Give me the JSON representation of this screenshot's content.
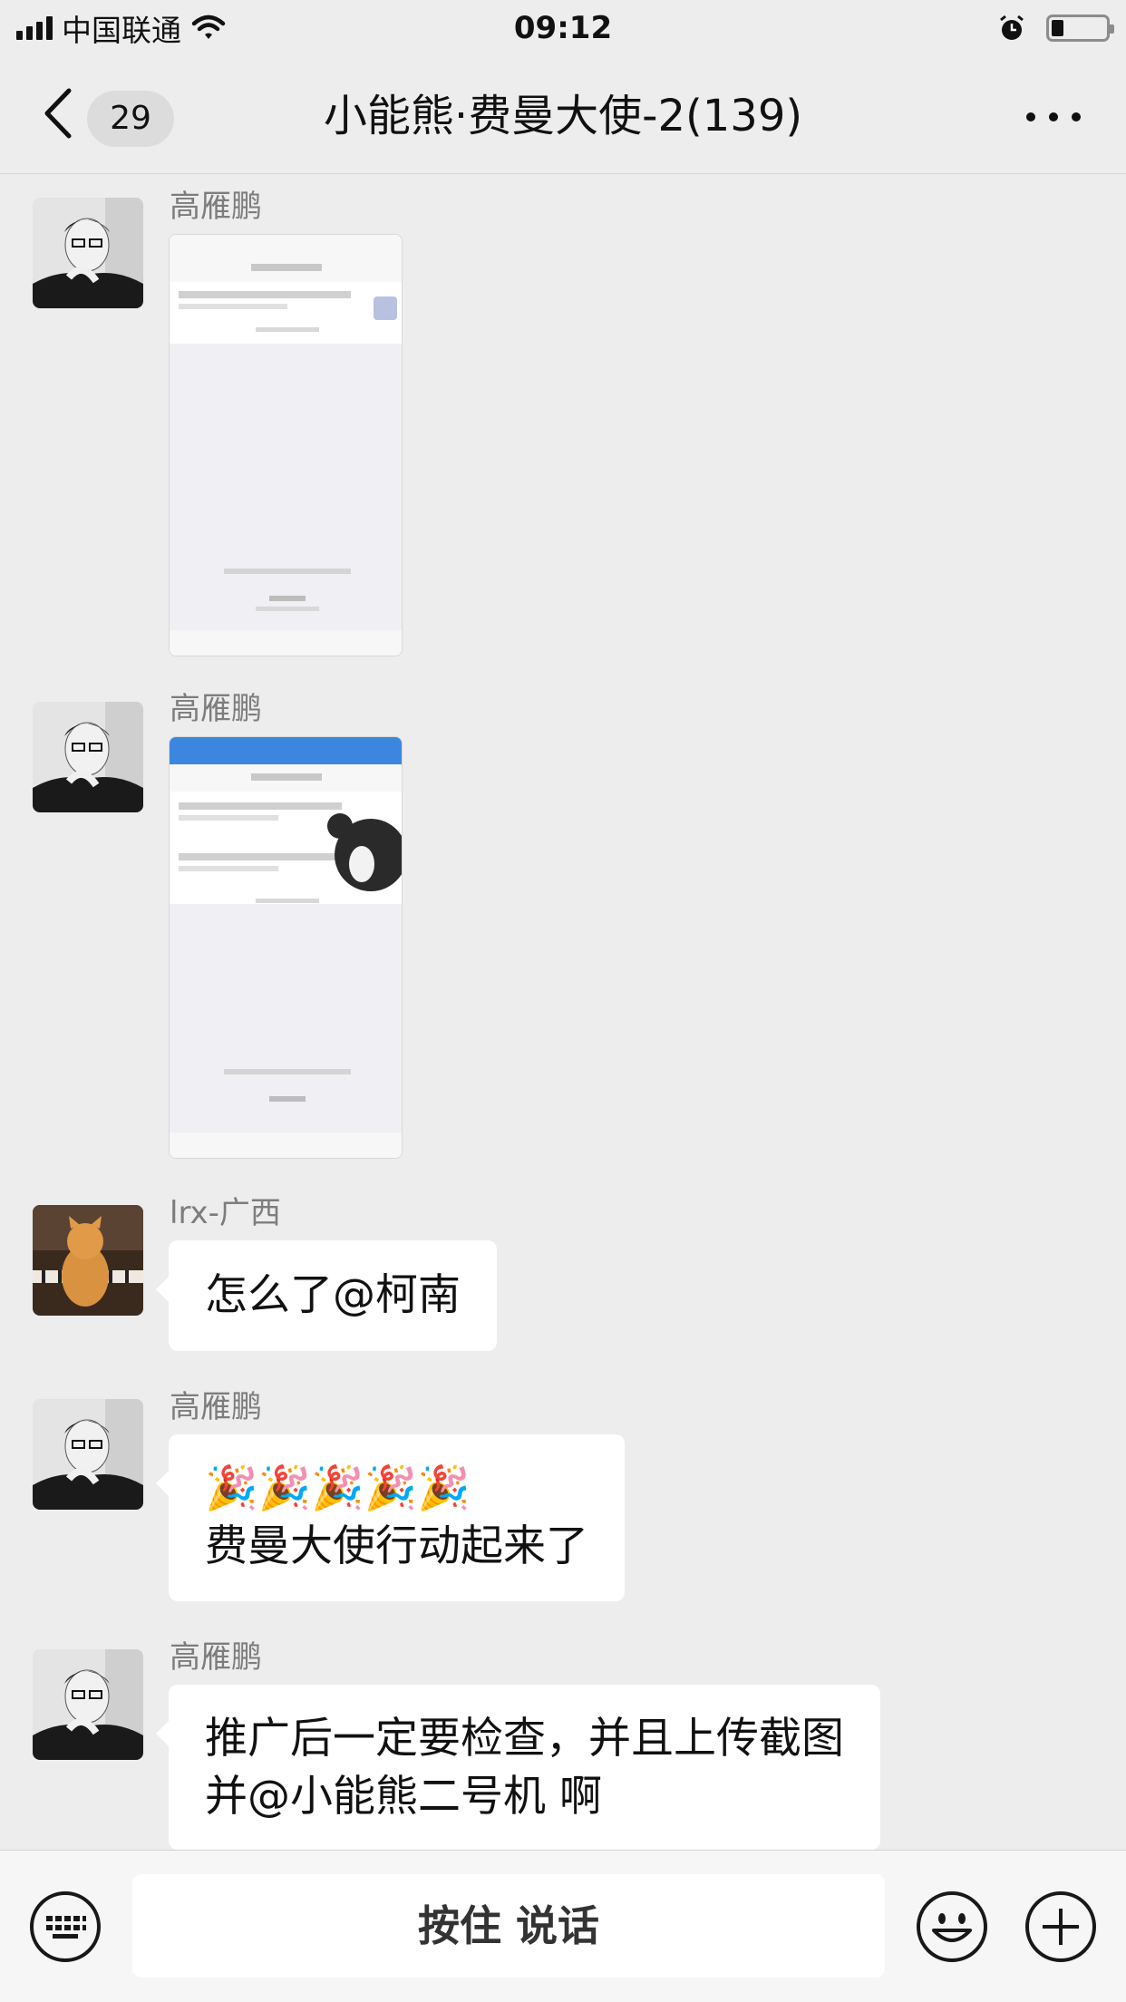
{
  "status_bar": {
    "carrier": "中国联通",
    "time": "09:12"
  },
  "nav": {
    "unread_count": "29",
    "title": "小能熊·费曼大使-2(139)"
  },
  "messages": [
    {
      "sender": "高雁鹏",
      "type": "image"
    },
    {
      "sender": "高雁鹏",
      "type": "image"
    },
    {
      "sender": "lrx-广西",
      "type": "text",
      "lines": [
        "怎么了@柯南"
      ]
    },
    {
      "sender": "高雁鹏",
      "type": "text",
      "lines": [
        "🎉🎉🎉🎉🎉",
        "费曼大使行动起来了"
      ]
    },
    {
      "sender": "高雁鹏",
      "type": "text",
      "lines": [
        "推广后一定要检查，并且上传截图",
        "并@小能熊二号机 啊"
      ]
    }
  ],
  "input_bar": {
    "hold_to_talk_label": "按住 说话"
  }
}
